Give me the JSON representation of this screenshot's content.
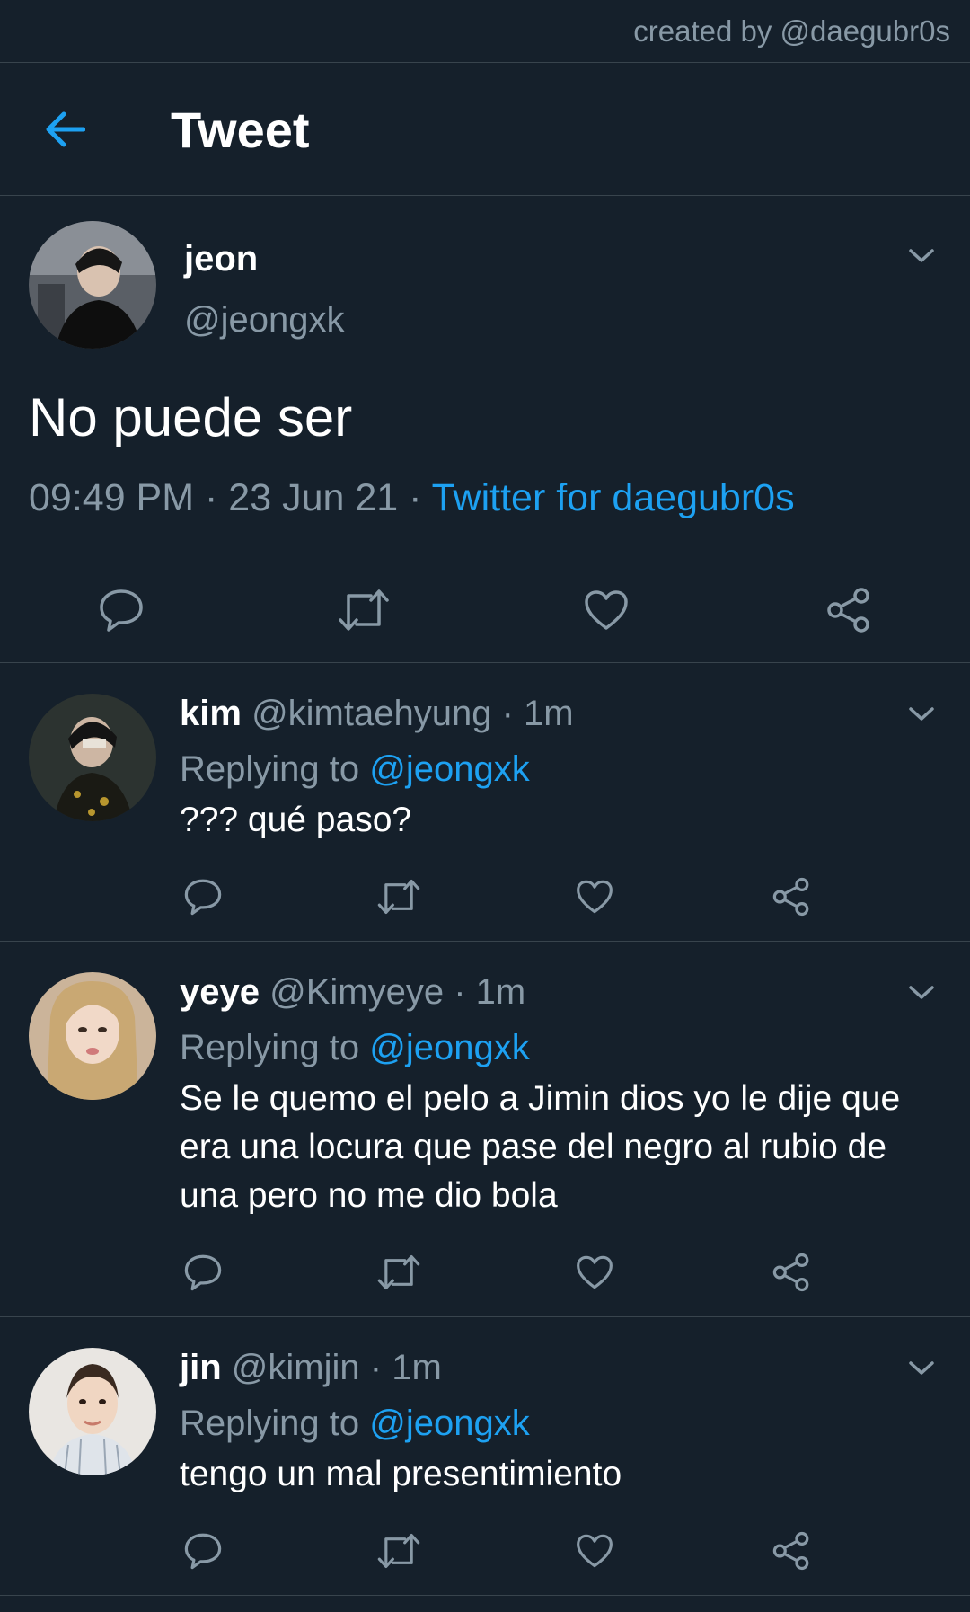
{
  "credit": "created by @daegubr0s",
  "header": {
    "title": "Tweet"
  },
  "main_tweet": {
    "name": "jeon",
    "handle": "@jeongxk",
    "text": "No puede ser",
    "time": "09:49 PM",
    "date": "23 Jun 21",
    "separator": "·",
    "source": "Twitter for daegubr0s"
  },
  "replies": [
    {
      "name": "kim",
      "handle": "@kimtaehyung",
      "age": "1m",
      "replying_label": "Replying to",
      "replying_to": "@jeongxk",
      "text": "??? qué paso?"
    },
    {
      "name": "yeye",
      "handle": "@Kimyeye",
      "age": "1m",
      "replying_label": "Replying to",
      "replying_to": "@jeongxk",
      "text": "Se le quemo el pelo a Jimin dios yo le dije que era una locura que pase del negro al rubio de una pero no me dio bola"
    },
    {
      "name": "jin",
      "handle": "@kimjin",
      "age": "1m",
      "replying_label": "Replying to",
      "replying_to": "@jeongxk",
      "text": "tengo un mal presentimiento"
    }
  ],
  "icons": {
    "back": "arrow-left-icon",
    "caret": "chevron-down-icon",
    "reply": "speech-bubble-icon",
    "retweet": "retweet-icon",
    "like": "heart-icon",
    "share": "share-icon"
  },
  "colors": {
    "background": "#15202b",
    "accent": "#1da1f2",
    "secondary_text": "#8899a6",
    "divider": "#38444d"
  }
}
